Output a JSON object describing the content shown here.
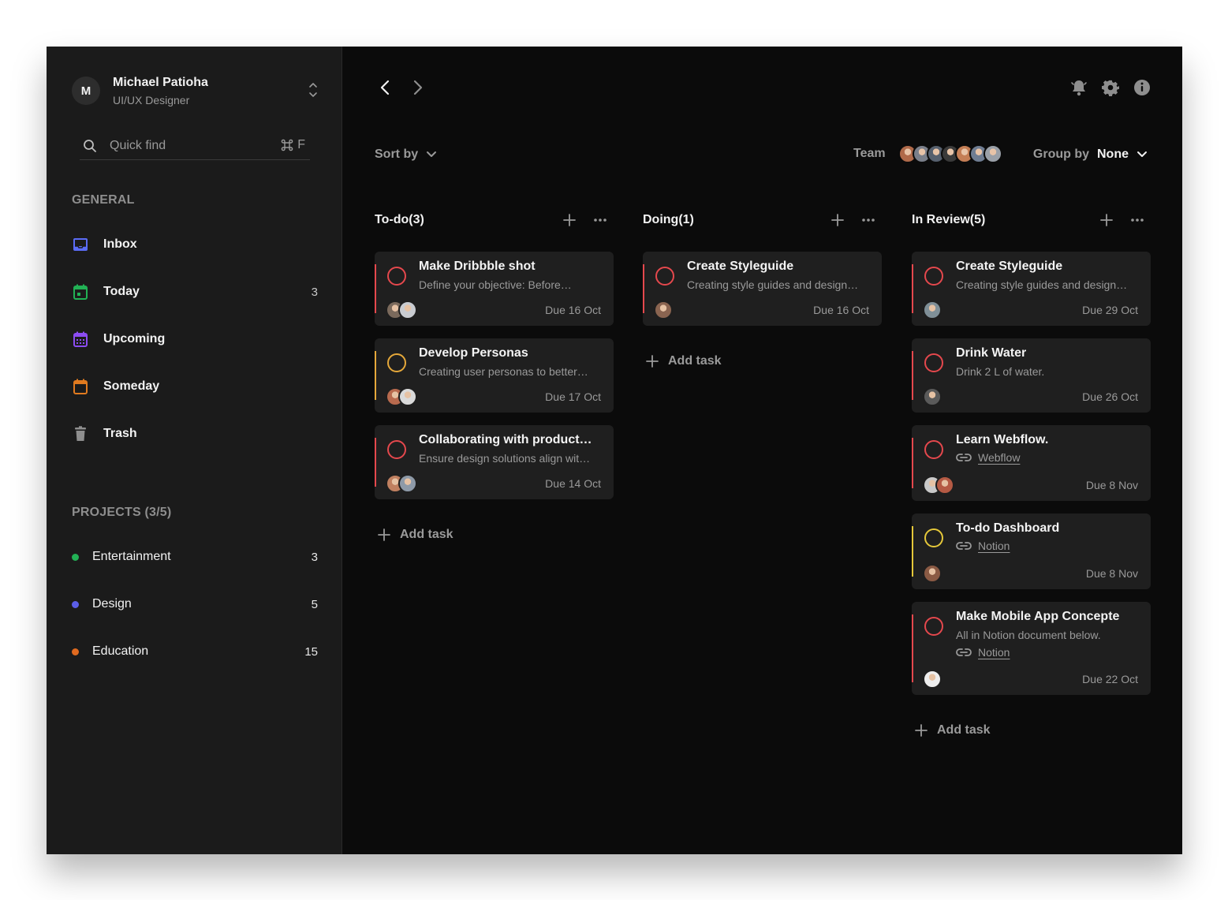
{
  "profile": {
    "initial": "M",
    "name": "Michael Patioha",
    "role": "UI/UX Designer"
  },
  "search": {
    "placeholder": "Quick find",
    "shortcut_key": "F"
  },
  "sidebar": {
    "general_title": "GENERAL",
    "items": [
      {
        "label": "Inbox",
        "count": "",
        "icon": "inbox-icon",
        "color": "#5b6cf5"
      },
      {
        "label": "Today",
        "count": "3",
        "icon": "calendar-today-icon",
        "color": "#22b155"
      },
      {
        "label": "Upcoming",
        "count": "",
        "icon": "calendar-upcoming-icon",
        "color": "#8b4cf2"
      },
      {
        "label": "Someday",
        "count": "",
        "icon": "calendar-someday-icon",
        "color": "#e07a1f"
      },
      {
        "label": "Trash",
        "count": "",
        "icon": "trash-icon",
        "color": "#8e8e8e"
      }
    ],
    "projects_title": "PROJECTS (3/5)",
    "projects": [
      {
        "label": "Entertainment",
        "count": "3",
        "color": "#22b155"
      },
      {
        "label": "Design",
        "count": "5",
        "color": "#5b5ee8"
      },
      {
        "label": "Education",
        "count": "15",
        "color": "#e06a1f"
      }
    ]
  },
  "toolbar": {
    "sort_label": "Sort by",
    "team_label": "Team",
    "group_label": "Group by",
    "group_value": "None",
    "team_avatar_colors": [
      "#b06a4a",
      "#7a7f8a",
      "#56606e",
      "#3a3a3a",
      "#c47e55",
      "#6f7d92",
      "#9aa0a8"
    ]
  },
  "columns": [
    {
      "title": "To-do(3)",
      "add_label": "Add task",
      "cards": [
        {
          "title": "Make Dribbble shot",
          "description": "Define your objective: Before…",
          "due": "Due 16 Oct",
          "accent": "#e5484d",
          "avatars": [
            "#7b6a5c",
            "#c9ccd1"
          ]
        },
        {
          "title": "Develop Personas",
          "description": "Creating user personas to better…",
          "due": "Due 17 Oct",
          "accent": "#e5a83a",
          "avatars": [
            "#b86a4e",
            "#dadada"
          ]
        },
        {
          "title": "Collaborating with product…",
          "description": "Ensure design solutions align wit…",
          "due": "Due 14 Oct",
          "accent": "#e5484d",
          "avatars": [
            "#c08060",
            "#8e9aa8"
          ]
        }
      ]
    },
    {
      "title": "Doing(1)",
      "add_label": "Add task",
      "cards": [
        {
          "title": "Create Styleguide",
          "description": "Creating style guides and design…",
          "due": "Due 16 Oct",
          "accent": "#e5484d",
          "avatars": [
            "#8a6450"
          ]
        }
      ]
    },
    {
      "title": "In Review(5)",
      "add_label": "Add task",
      "cards": [
        {
          "title": "Create Styleguide",
          "description": "Creating style guides and design…",
          "due": "Due 29 Oct",
          "accent": "#e5484d",
          "avatars": [
            "#7f8f97"
          ]
        },
        {
          "title": "Drink Water",
          "description": "Drink 2 L of water.",
          "due": "Due 26 Oct",
          "accent": "#e5484d",
          "avatars": [
            "#5a5a5a"
          ]
        },
        {
          "title": "Learn Webflow.",
          "link": "Webflow",
          "due": "Due 8 Nov",
          "accent": "#e5484d",
          "avatars": [
            "#c9c9c9",
            "#b55a44"
          ]
        },
        {
          "title": "To-do Dashboard",
          "link": "Notion",
          "due": "Due 8 Nov",
          "accent": "#e5c83a",
          "avatars": [
            "#8a5a44"
          ]
        },
        {
          "title": "Make Mobile App Concepte",
          "description": "All in Notion document below.",
          "link": "Notion",
          "due": "Due 22 Oct",
          "accent": "#e5484d",
          "avatars": [
            "#eeeeee"
          ]
        }
      ]
    }
  ]
}
